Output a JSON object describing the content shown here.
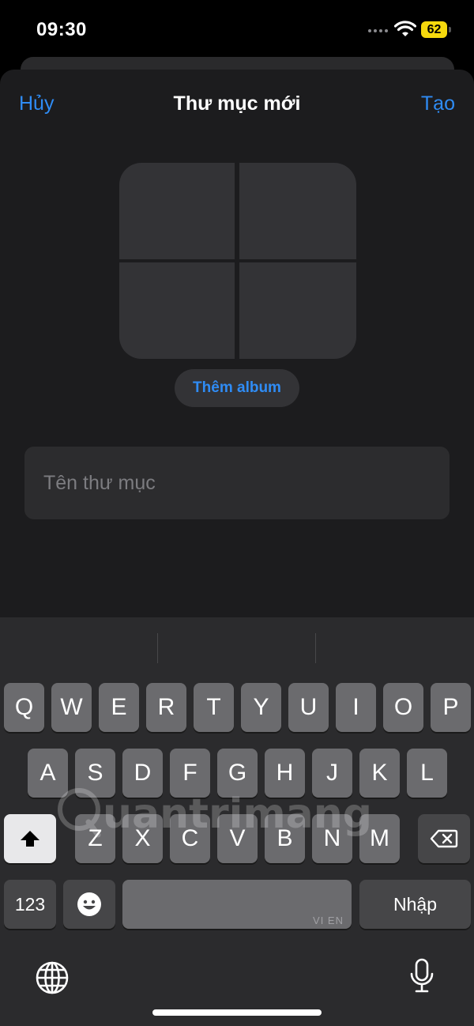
{
  "status_bar": {
    "time": "09:30",
    "battery": "62"
  },
  "nav": {
    "cancel_label": "Hủy",
    "title": "Thư mục mới",
    "create_label": "Tạo"
  },
  "add_album_label": "Thêm album",
  "folder_name": {
    "value": "",
    "placeholder": "Tên thư mục"
  },
  "keyboard": {
    "row1": [
      "Q",
      "W",
      "E",
      "R",
      "T",
      "Y",
      "U",
      "I",
      "O",
      "P"
    ],
    "row2": [
      "A",
      "S",
      "D",
      "F",
      "G",
      "H",
      "J",
      "K",
      "L"
    ],
    "row3": [
      "Z",
      "X",
      "C",
      "V",
      "B",
      "N",
      "M"
    ],
    "numbers_label": "123",
    "space_lang": "VI EN",
    "return_label": "Nhập"
  },
  "watermark": "uantrimang",
  "colors": {
    "accent": "#2f8cf5",
    "sheet": "#1c1c1e",
    "battery": "#f6d90d"
  }
}
